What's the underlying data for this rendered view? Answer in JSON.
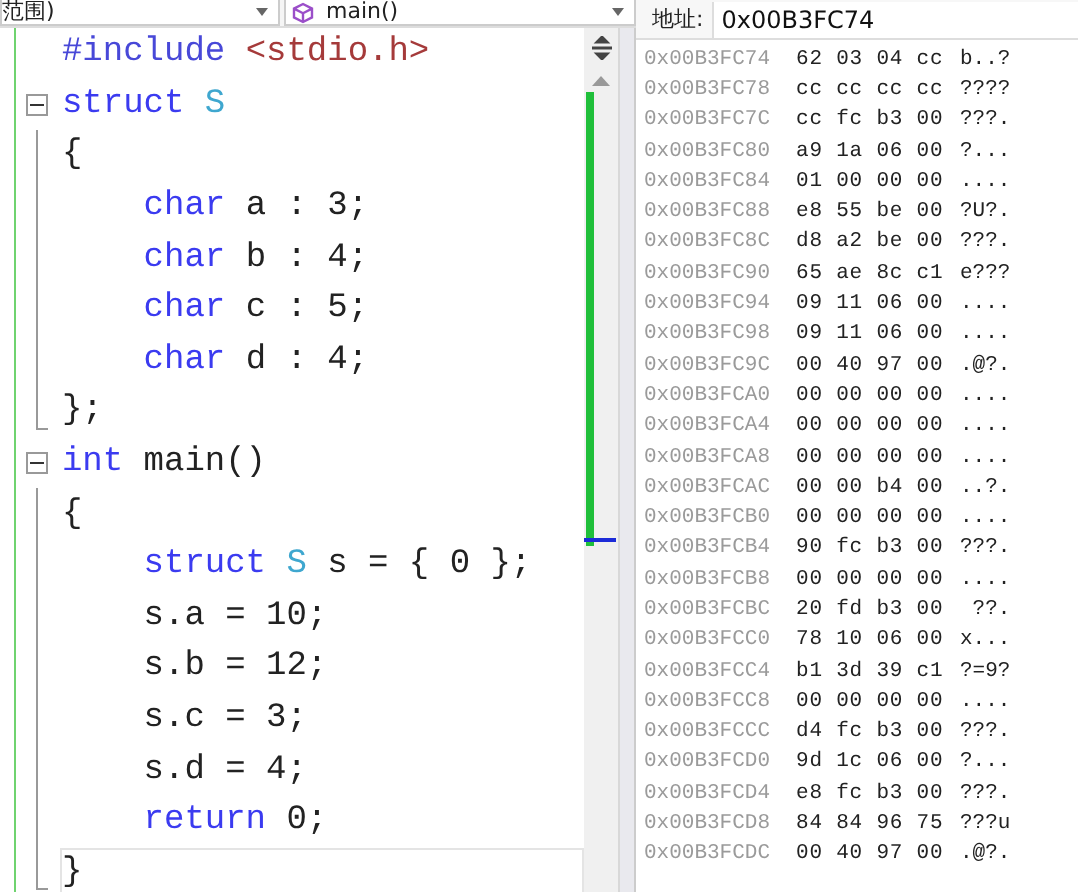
{
  "editor": {
    "scope_dropdown": {
      "value": "范围)"
    },
    "member_dropdown": {
      "value": "main()"
    },
    "code": [
      {
        "tokens": [
          {
            "kind": "preproc",
            "text": "#include "
          },
          {
            "kind": "string",
            "text": "<stdio.h>"
          }
        ]
      },
      {
        "tokens": [
          {
            "kind": "keyword",
            "text": "struct "
          },
          {
            "kind": "type",
            "text": "S"
          }
        ],
        "expanded": true,
        "children": [
          {
            "tokens": [
              {
                "kind": "plain",
                "text": "{"
              }
            ]
          },
          {
            "tokens": [
              {
                "kind": "keyword",
                "text": "    char "
              },
              {
                "kind": "plain",
                "text": "a : 3;"
              }
            ]
          },
          {
            "tokens": [
              {
                "kind": "keyword",
                "text": "    char "
              },
              {
                "kind": "plain",
                "text": "b : 4;"
              }
            ]
          },
          {
            "tokens": [
              {
                "kind": "keyword",
                "text": "    char "
              },
              {
                "kind": "plain",
                "text": "c : 5;"
              }
            ]
          },
          {
            "tokens": [
              {
                "kind": "keyword",
                "text": "    char "
              },
              {
                "kind": "plain",
                "text": "d : 4;"
              }
            ]
          },
          {
            "tokens": [
              {
                "kind": "plain",
                "text": "};"
              }
            ]
          }
        ]
      },
      {
        "tokens": [
          {
            "kind": "keyword",
            "text": "int "
          },
          {
            "kind": "plain",
            "text": "main()"
          }
        ],
        "expanded": true,
        "children": [
          {
            "tokens": [
              {
                "kind": "plain",
                "text": "{"
              }
            ]
          },
          {
            "tokens": [
              {
                "kind": "keyword",
                "text": "    struct "
              },
              {
                "kind": "type",
                "text": "S"
              },
              {
                "kind": "plain",
                "text": " s = { 0 };"
              }
            ]
          },
          {
            "tokens": [
              {
                "kind": "plain",
                "text": "    s.a = 10;"
              }
            ]
          },
          {
            "tokens": [
              {
                "kind": "plain",
                "text": "    s.b = 12;"
              }
            ]
          },
          {
            "tokens": [
              {
                "kind": "plain",
                "text": "    s.c = 3;"
              }
            ]
          },
          {
            "tokens": [
              {
                "kind": "plain",
                "text": "    s.d = 4;"
              }
            ]
          },
          {
            "tokens": [
              {
                "kind": "keyword",
                "text": "    return "
              },
              {
                "kind": "plain",
                "text": "0;"
              }
            ]
          },
          {
            "tokens": [
              {
                "kind": "plain",
                "text": "}"
              }
            ],
            "current": true
          }
        ]
      }
    ]
  },
  "memory": {
    "address_label": "地址:",
    "address": "0x00B3FC74",
    "rows": [
      {
        "address": "0x00B3FC74",
        "bytes": "62 03 04 cc",
        "text": "b..?"
      },
      {
        "address": "0x00B3FC78",
        "bytes": "cc cc cc cc",
        "text": "????"
      },
      {
        "address": "0x00B3FC7C",
        "bytes": "cc fc b3 00",
        "text": "???."
      },
      {
        "address": "0x00B3FC80",
        "bytes": "a9 1a 06 00",
        "text": "?..."
      },
      {
        "address": "0x00B3FC84",
        "bytes": "01 00 00 00",
        "text": "...."
      },
      {
        "address": "0x00B3FC88",
        "bytes": "e8 55 be 00",
        "text": "?U?."
      },
      {
        "address": "0x00B3FC8C",
        "bytes": "d8 a2 be 00",
        "text": "???."
      },
      {
        "address": "0x00B3FC90",
        "bytes": "65 ae 8c c1",
        "text": "e???"
      },
      {
        "address": "0x00B3FC94",
        "bytes": "09 11 06 00",
        "text": "...."
      },
      {
        "address": "0x00B3FC98",
        "bytes": "09 11 06 00",
        "text": "...."
      },
      {
        "address": "0x00B3FC9C",
        "bytes": "00 40 97 00",
        "text": ".@?."
      },
      {
        "address": "0x00B3FCA0",
        "bytes": "00 00 00 00",
        "text": "...."
      },
      {
        "address": "0x00B3FCA4",
        "bytes": "00 00 00 00",
        "text": "...."
      },
      {
        "address": "0x00B3FCA8",
        "bytes": "00 00 00 00",
        "text": "...."
      },
      {
        "address": "0x00B3FCAC",
        "bytes": "00 00 b4 00",
        "text": "..?."
      },
      {
        "address": "0x00B3FCB0",
        "bytes": "00 00 00 00",
        "text": "...."
      },
      {
        "address": "0x00B3FCB4",
        "bytes": "90 fc b3 00",
        "text": "???."
      },
      {
        "address": "0x00B3FCB8",
        "bytes": "00 00 00 00",
        "text": "...."
      },
      {
        "address": "0x00B3FCBC",
        "bytes": "20 fd b3 00",
        "text": " ??."
      },
      {
        "address": "0x00B3FCC0",
        "bytes": "78 10 06 00",
        "text": "x..."
      },
      {
        "address": "0x00B3FCC4",
        "bytes": "b1 3d 39 c1",
        "text": "?=9?"
      },
      {
        "address": "0x00B3FCC8",
        "bytes": "00 00 00 00",
        "text": "...."
      },
      {
        "address": "0x00B3FCCC",
        "bytes": "d4 fc b3 00",
        "text": "???."
      },
      {
        "address": "0x00B3FCD0",
        "bytes": "9d 1c 06 00",
        "text": "?..."
      },
      {
        "address": "0x00B3FCD4",
        "bytes": "e8 fc b3 00",
        "text": "???."
      },
      {
        "address": "0x00B3FCD8",
        "bytes": "84 84 96 75",
        "text": "???u"
      },
      {
        "address": "0x00B3FCDC",
        "bytes": "00 40 97 00",
        "text": ".@?."
      }
    ]
  }
}
